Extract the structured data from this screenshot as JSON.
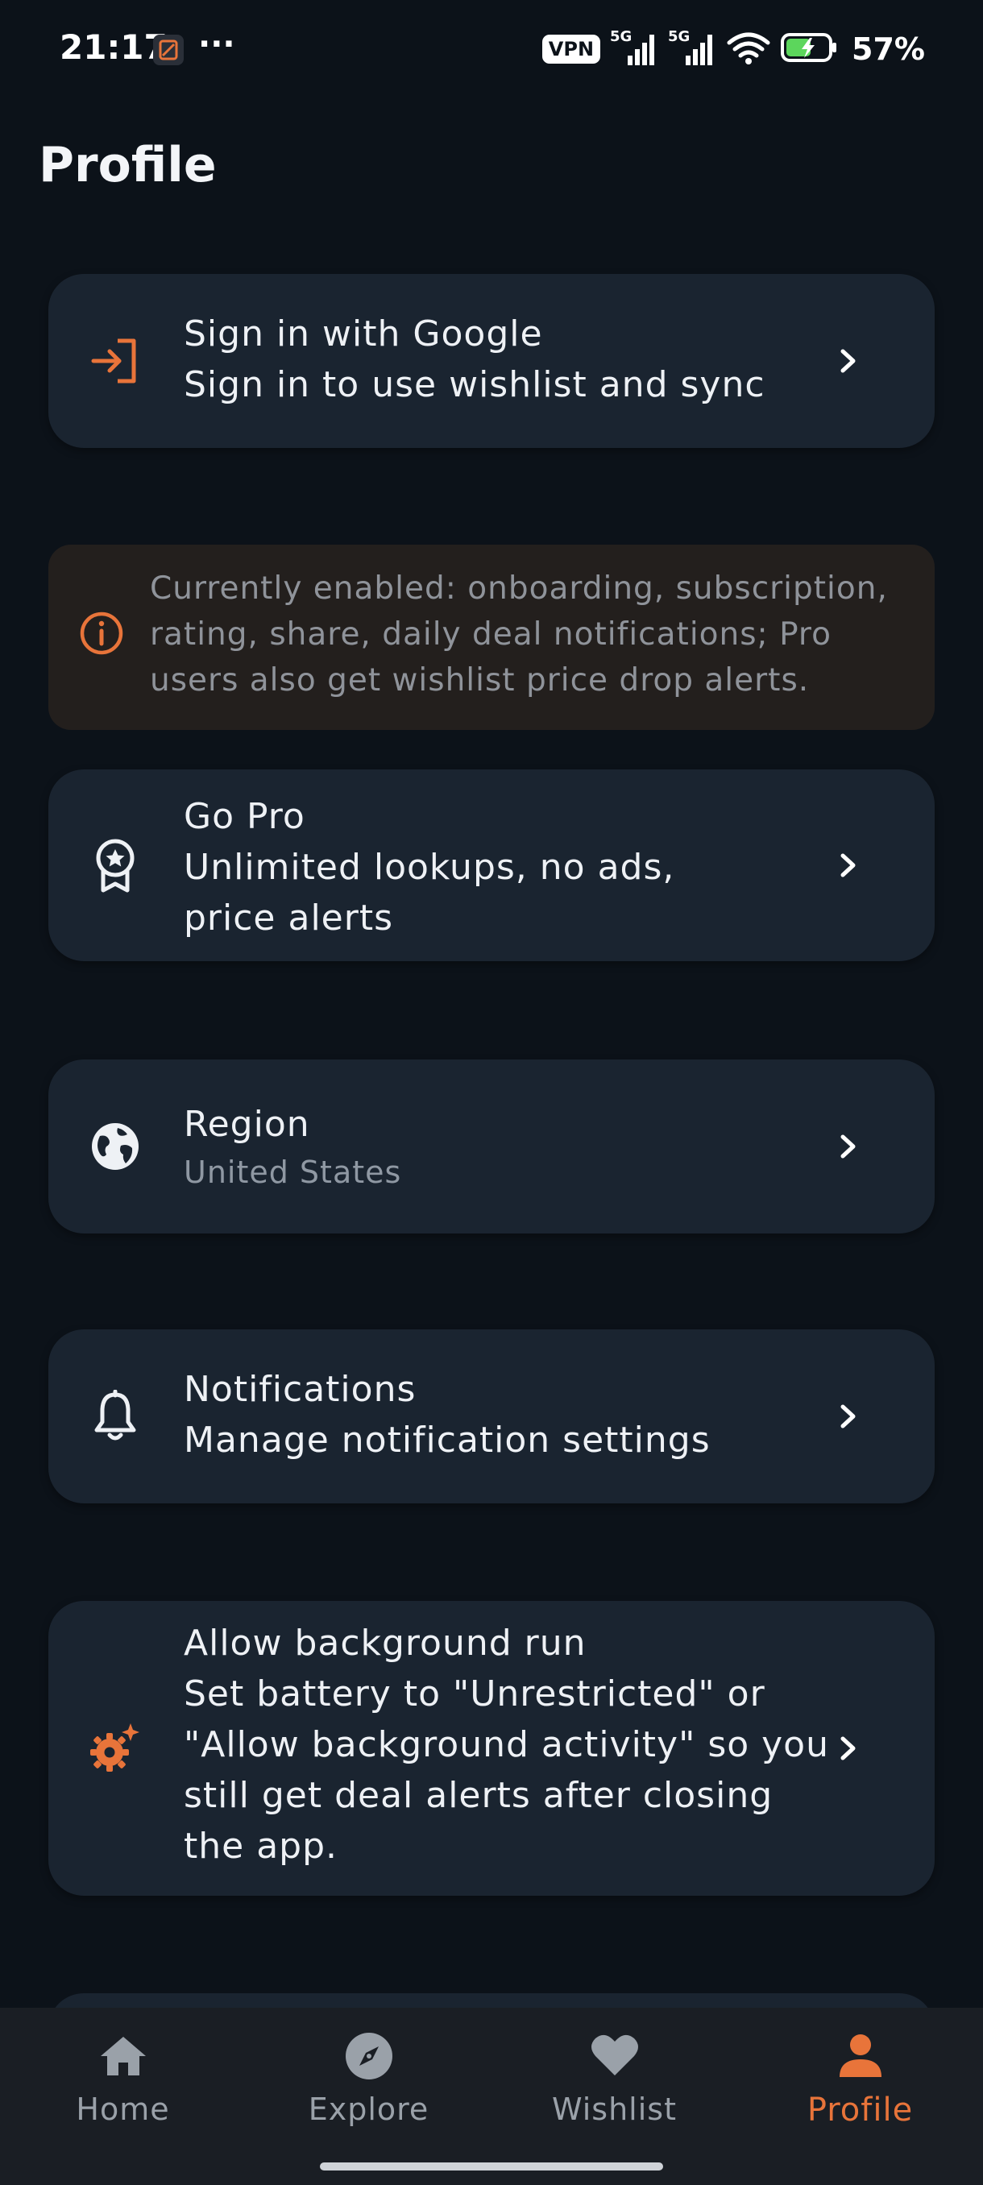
{
  "status_bar": {
    "time": "21:17",
    "dots": "···",
    "vpn": "VPN",
    "network_1": "5G",
    "network_2": "5G",
    "battery": "57%"
  },
  "header": {
    "title": "Profile"
  },
  "cards": {
    "signin": {
      "title": "Sign in with Google",
      "subtitle": "Sign in to use wishlist and sync",
      "icon": "login-icon"
    },
    "info": {
      "text": "Currently enabled: onboarding, subscription, rating, share, daily deal notifications; Pro users also get wishlist price drop alerts.",
      "icon": "info-icon"
    },
    "pro": {
      "title": "Go Pro",
      "subtitle": "Unlimited lookups, no ads, price alerts",
      "icon": "award-badge-icon"
    },
    "region": {
      "title": "Region",
      "subtitle": "United States",
      "icon": "globe-icon"
    },
    "notifications": {
      "title": "Notifications",
      "subtitle": "Manage notification settings",
      "icon": "bell-icon"
    },
    "background": {
      "title": "Allow background run",
      "subtitle": "Set battery to \"Unrestricted\" or \"Allow background activity\" so you still get deal alerts after closing the app.",
      "icon": "gear-sparkle-icon"
    }
  },
  "bottom_nav": {
    "items": [
      {
        "label": "Home",
        "icon": "home-icon",
        "active": false
      },
      {
        "label": "Explore",
        "icon": "compass-icon",
        "active": false
      },
      {
        "label": "Wishlist",
        "icon": "heart-icon",
        "active": false
      },
      {
        "label": "Profile",
        "icon": "person-icon",
        "active": true
      }
    ]
  },
  "colors": {
    "accent": "#e8743a",
    "background": "#0c1219",
    "card": "#1a2430",
    "banner": "#231f1d",
    "nav": "#1a1e24"
  }
}
